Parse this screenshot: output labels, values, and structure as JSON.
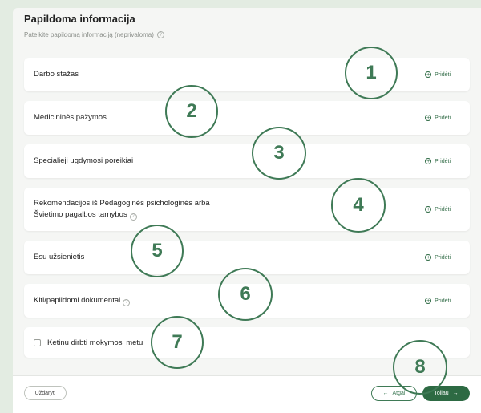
{
  "header": {
    "title": "Papildoma informacija",
    "subtitle": "Pateikite papildomą informaciją (neprivaloma)",
    "help_icon": "question-circle-icon"
  },
  "rows": [
    {
      "label": "Darbo stažas",
      "action": "Pridėti"
    },
    {
      "label": "Medicininės pažymos",
      "action": "Pridėti"
    },
    {
      "label": "Specialieji ugdymosi poreikiai",
      "action": "Pridėti"
    },
    {
      "label_line1": "Rekomendacijos iš Pedagoginės psichologinės arba",
      "label_line2": "Švietimo pagalbos tarnybos",
      "action": "Pridėti"
    },
    {
      "label": "Esu užsienietis",
      "action": "Pridėti"
    },
    {
      "label": "Kiti/papildomi dokumentai",
      "action": "Pridėti"
    }
  ],
  "checkbox": {
    "label": "Ketinu dirbti mokymosi metu",
    "checked": false
  },
  "footer": {
    "close_label": "Uždaryti",
    "back_label": "Atgal",
    "next_label": "Toliau"
  },
  "markers": [
    "1",
    "2",
    "3",
    "4",
    "5",
    "6",
    "7",
    "8"
  ],
  "colors": {
    "accent": "#2d6a43",
    "marker": "#3f7a56",
    "background": "#e3ece2"
  }
}
